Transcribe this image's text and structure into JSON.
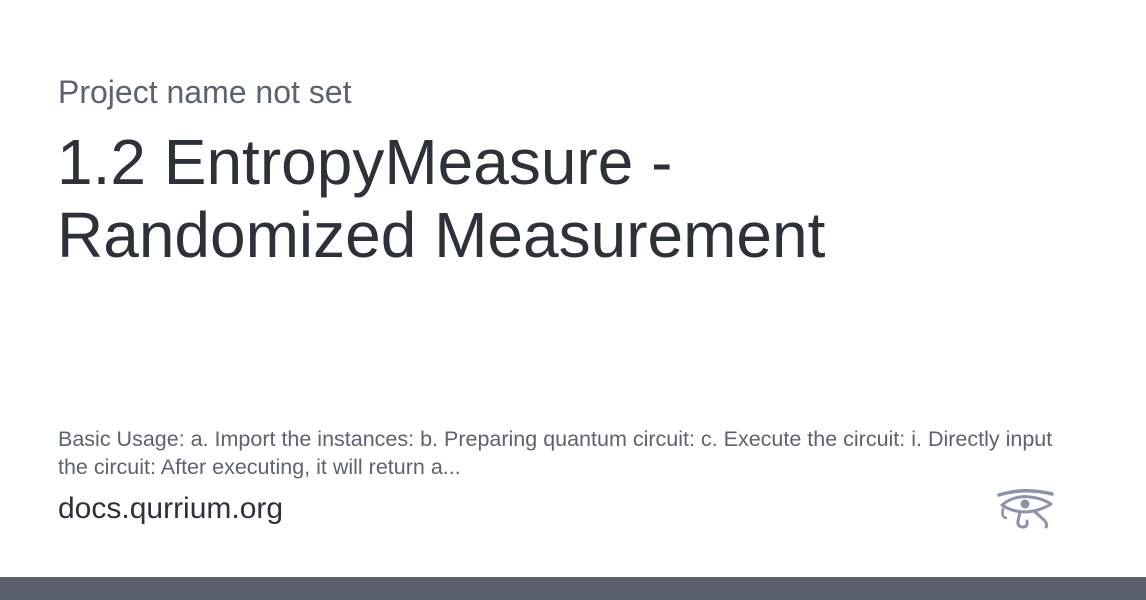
{
  "card": {
    "project_name": "Project name not set",
    "title": "1.2 EntropyMeasure - Randomized Measurement",
    "description": "Basic Usage: a. Import the instances: b. Preparing quantum circuit: c. Execute the circuit: i. Directly input the circuit: After executing, it will return a...",
    "site": "docs.qurrium.org",
    "logo_icon": "eye-of-horus-icon"
  },
  "colors": {
    "title": "#2d3139",
    "muted_text": "#5c6370",
    "logo": "#8a93a8",
    "bottom_bar": "#5a606c"
  }
}
